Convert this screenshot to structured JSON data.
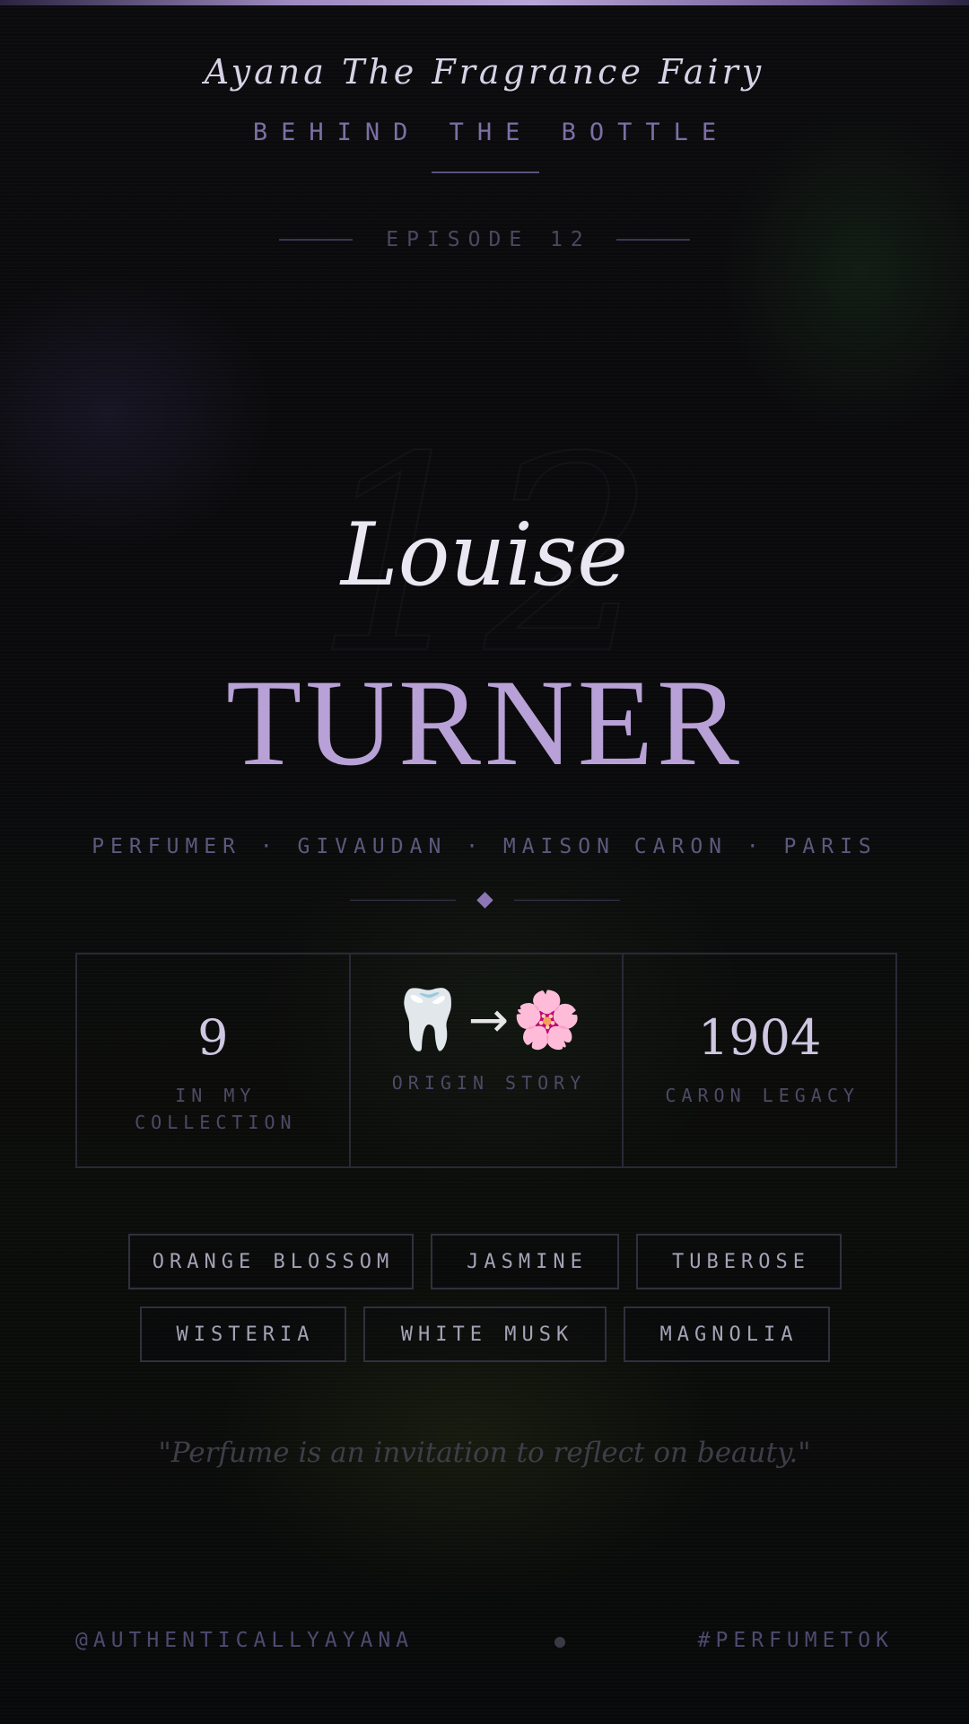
{
  "header": {
    "brand": "Ayana The Fragrance Fairy",
    "series": "BEHIND THE BOTTLE",
    "episode": "EPISODE 12",
    "watermark": "12"
  },
  "profile": {
    "first_name": "Louise",
    "last_name": "TURNER",
    "credits": "PERFUMER · GIVAUDAN · MAISON CARON · PARIS"
  },
  "stats": [
    {
      "value": "9",
      "label": "IN MY COLLECTION"
    },
    {
      "value": "🦷→🌸",
      "label": "ORIGIN STORY",
      "icons": [
        "tooth-emoji",
        "arrow",
        "cherry-blossom-emoji"
      ]
    },
    {
      "value": "1904",
      "label": "CARON LEGACY"
    }
  ],
  "notes": {
    "row1": [
      "ORANGE BLOSSOM",
      "JASMINE",
      "TUBEROSE"
    ],
    "row2": [
      "WISTERIA",
      "WHITE MUSK",
      "MAGNOLIA"
    ]
  },
  "quote": "\"Perfume is an invitation to reflect on beauty.\"",
  "footer": {
    "handle": "@AUTHENTICALLYAYANA",
    "hashtag": "#PERFUMETOK"
  },
  "colors": {
    "accent": "#b8a1d6",
    "background": "#0a0a0c",
    "muted_text": "#5e587e"
  }
}
